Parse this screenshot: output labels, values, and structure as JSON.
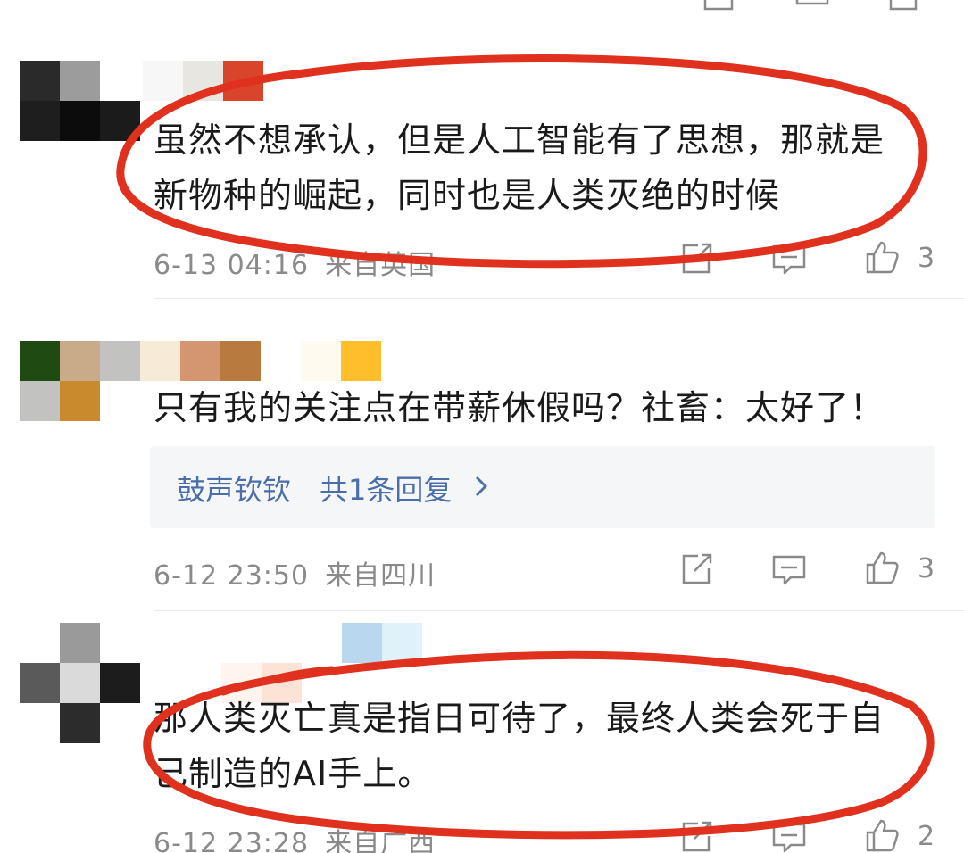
{
  "comments": [
    {
      "text_line1": "虽然不想承认，但是人工智能有了思想，那就是",
      "text_line2": "新物种的崛起，同时也是人类灭绝的时候",
      "date": "6-13 04:16",
      "location": "来自英国",
      "likes": "3"
    },
    {
      "text_line1": "只有我的关注点在带薪休假吗？社畜：太好了！",
      "date": "6-12 23:50",
      "location": "来自四川",
      "likes": "3",
      "reply": {
        "name": "鼓声钦钦",
        "count_label": "共1条回复"
      }
    },
    {
      "text_line1": "那人类灭亡真是指日可待了，最终人类会死于自",
      "text_line2": "己制造的AI手上。",
      "date": "6-12 23:28",
      "location": "来自广西",
      "likes": "2"
    }
  ],
  "icons": {
    "share": "share-icon",
    "comment": "comment-icon",
    "like": "thumbs-up-icon"
  },
  "colors": {
    "annotation_red": "#e0301e",
    "link_blue": "#4a6ea9",
    "meta_gray": "#8a8a8a"
  }
}
